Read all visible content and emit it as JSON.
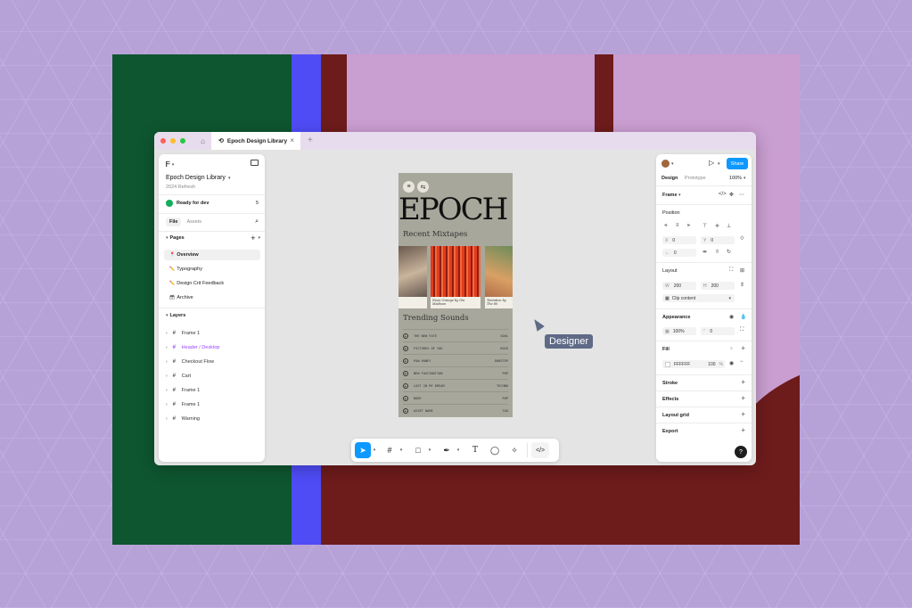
{
  "window": {
    "home_icon": "home-icon",
    "tab_label": "Epoch Design Library",
    "tab_close": "×",
    "new_tab": "+"
  },
  "left_panel": {
    "file_name": "Epoch Design Library",
    "file_sub": "2024 Refresh",
    "ready_label": "Ready for dev",
    "ready_count": "5",
    "tab_file": "File",
    "tab_assets": "Assets",
    "pages_header": "Pages",
    "pages": [
      {
        "icon": "📍",
        "label": "Overview"
      },
      {
        "icon": "✏️",
        "label": "Typography"
      },
      {
        "icon": "✏️",
        "label": "Design Crit Feedback"
      },
      {
        "icon": "🗃",
        "label": "Archive"
      }
    ],
    "layers_header": "Layers",
    "layers": [
      {
        "label": "Frame 1"
      },
      {
        "label": "Header / Desktop"
      },
      {
        "label": "Checkout Flow"
      },
      {
        "label": "Cart"
      },
      {
        "label": "Frame 1"
      },
      {
        "label": "Frame 1"
      },
      {
        "label": "Warning"
      }
    ]
  },
  "canvas": {
    "phone": {
      "title": "EPOCH",
      "recent_heading": "Recent Mixtapes",
      "cards": [
        {
          "caption": ""
        },
        {
          "caption": "Neon Orange by Gin Madison"
        },
        {
          "caption": "Tentative by The 80"
        }
      ],
      "trending_heading": "Trending Sounds",
      "songs": [
        {
          "title": "THE NEW FATE",
          "genre": "SOUL"
        },
        {
          "title": "PICTURES OF YOU",
          "genre": "ROCK"
        },
        {
          "title": "PAW HONEY",
          "genre": "DUBSTEP"
        },
        {
          "title": "NEW FASCINATION",
          "genre": "POP"
        },
        {
          "title": "LOST IN MY DREAM",
          "genre": "TECHNO"
        },
        {
          "title": "BABY",
          "genre": "POP"
        },
        {
          "title": "ASSET NAME",
          "genre": "TAG"
        }
      ]
    },
    "cursor_label": "Designer"
  },
  "toolbar": {
    "code_label": "</>"
  },
  "right_panel": {
    "share_label": "Share",
    "tab_design": "Design",
    "tab_prototype": "Prototype",
    "zoom": "100%",
    "frame_label": "Frame",
    "position_label": "Position",
    "x_label": "X",
    "x_value": "0",
    "y_label": "Y",
    "y_value": "0",
    "rot_value": "0",
    "layout_label": "Layout",
    "w_label": "W",
    "w_value": "200",
    "h_label": "H",
    "h_value": "200",
    "clip_label": "Clip content",
    "appearance_label": "Appearance",
    "opacity_value": "100%",
    "radius_value": "0",
    "fill_label": "Fill",
    "fill_hex": "FFFFFF",
    "fill_opacity": "100",
    "fill_pct": "%",
    "stroke_label": "Stroke",
    "effects_label": "Effects",
    "layout_grid_label": "Layout grid",
    "export_label": "Export",
    "help": "?"
  },
  "colors": {
    "accent": "#0d99ff",
    "art_green": "#0e5630",
    "art_blue": "#4f4cf6",
    "art_maroon": "#6e1b1b",
    "art_pink": "#c99ed0",
    "layer_selected": "#9747ff",
    "cursor_label_bg": "#5e6a86"
  }
}
